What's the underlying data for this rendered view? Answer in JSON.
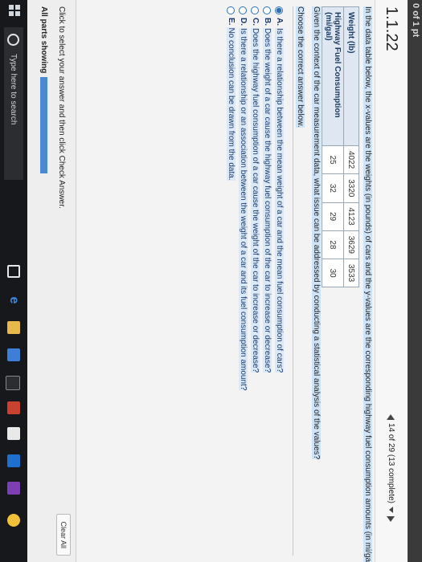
{
  "header": {
    "points": "0 of 1 pt",
    "question_number": "1.1.22",
    "nav": "14 of 29 (13 complete)"
  },
  "question": {
    "intro_start": "In the data table below, the x-values are the weights (in pounds) of cars and the y-values are the corresponding highway fuel consumption amounts (in mi/gal).",
    "table": {
      "rows": [
        {
          "label": "Weight (lb)",
          "values": [
            "4022",
            "3320",
            "4123",
            "3629",
            "3533"
          ]
        },
        {
          "label": "Highway Fuel Consumption (mi/gal)",
          "values": [
            "25",
            "32",
            "29",
            "28",
            "30"
          ]
        }
      ]
    },
    "context": "Given the context of the car measurement data, what issue can be addressed by conducting a statistical analysis of the values?",
    "choose": "Choose the correct answer below.",
    "options": [
      {
        "letter": "A.",
        "text": "Is there a relationship between the mean weight of a car and the mean fuel consumption of cars?",
        "selected": true
      },
      {
        "letter": "B.",
        "text": "Does the weight of a car cause the highway fuel consumption of the car to increase or decrease?",
        "selected": false
      },
      {
        "letter": "C.",
        "text": "Does the highway fuel consumption of a car cause the weight of the car to increase or decrease?",
        "selected": false
      },
      {
        "letter": "D.",
        "text": "Is there a relationship or an association between the weight of a car and its fuel consumption amount?",
        "selected": false
      },
      {
        "letter": "E.",
        "text": "No conclusion can be drawn from the data.",
        "selected": false
      }
    ]
  },
  "footer": {
    "instruction": "Click to select your answer and then click Check Answer.",
    "clear_all": "Clear All",
    "parts_label": "All parts showing"
  },
  "taskbar": {
    "search_placeholder": "Type here to search"
  },
  "colors": {
    "accent": "#2c6fb5",
    "progress": "#4a88cf",
    "taskbar": "#17181b"
  }
}
